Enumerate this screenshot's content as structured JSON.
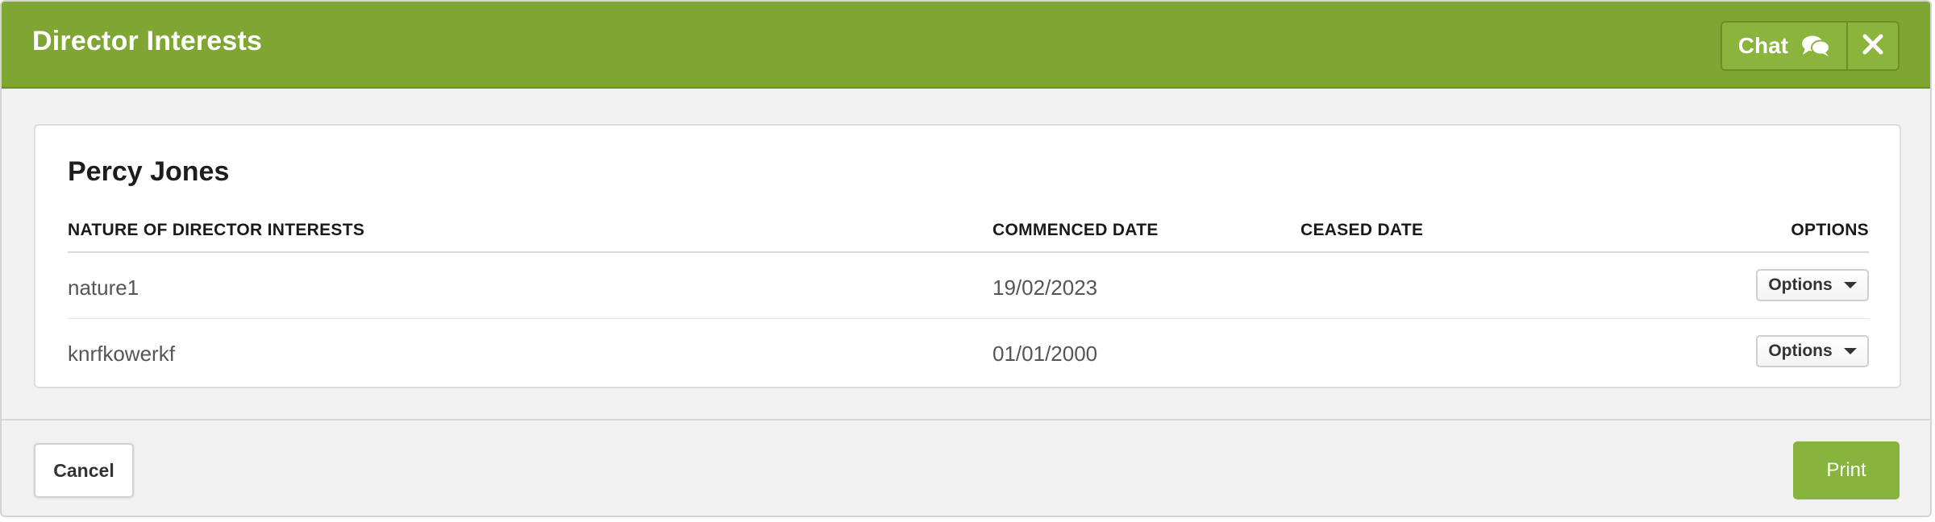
{
  "modal": {
    "title": "Director Interests"
  },
  "header": {
    "chat_label": "Chat",
    "chat_icon": "chat-bubbles-icon",
    "close_icon": "close-icon"
  },
  "card": {
    "person_name": "Percy Jones"
  },
  "table": {
    "columns": [
      "NATURE OF DIRECTOR INTERESTS",
      "COMMENCED DATE",
      "CEASED DATE",
      "OPTIONS"
    ],
    "rows": [
      {
        "nature": "nature1",
        "commenced": "19/02/2023",
        "ceased": "",
        "options_label": "Options"
      },
      {
        "nature": "knrfkowerkf",
        "commenced": "01/01/2000",
        "ceased": "",
        "options_label": "Options"
      }
    ]
  },
  "footer": {
    "cancel_label": "Cancel",
    "print_label": "Print"
  },
  "colors": {
    "header_bg": "#7fa632",
    "print_bg": "#86b33b",
    "modal_bg": "#f1f1f1"
  }
}
